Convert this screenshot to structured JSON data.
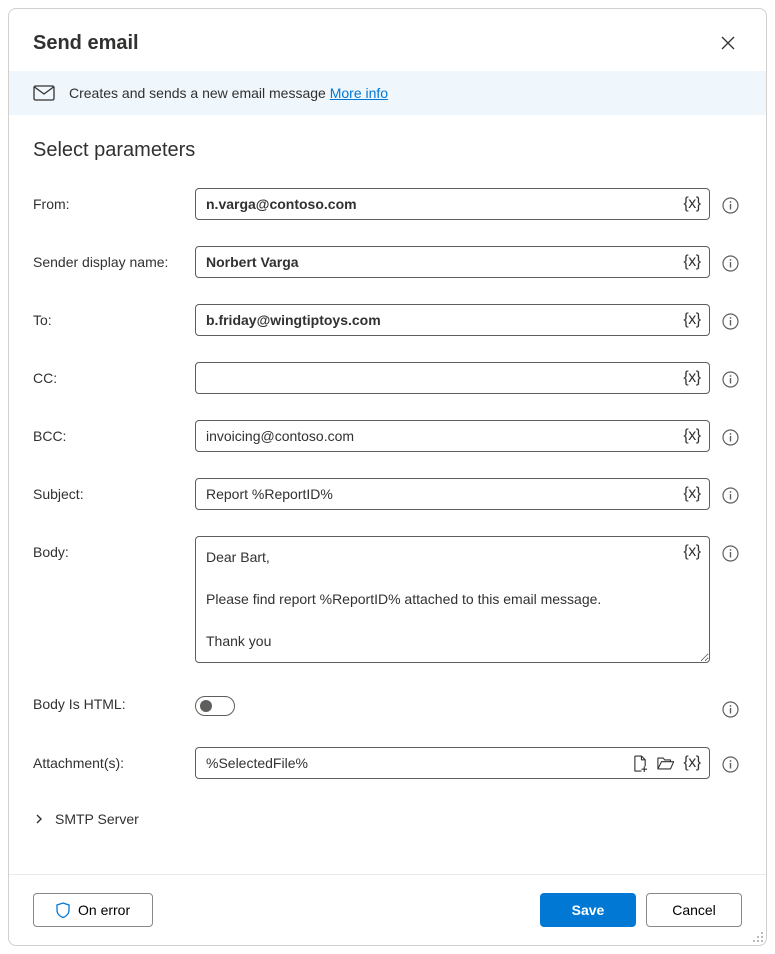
{
  "header": {
    "title": "Send email"
  },
  "info": {
    "text": "Creates and sends a new email message ",
    "link": "More info"
  },
  "section_title": "Select parameters",
  "params": {
    "from": {
      "label": "From:",
      "value": "n.varga@contoso.com"
    },
    "sender": {
      "label": "Sender display name:",
      "value": "Norbert Varga"
    },
    "to": {
      "label": "To:",
      "value": "b.friday@wingtiptoys.com"
    },
    "cc": {
      "label": "CC:",
      "value": ""
    },
    "bcc": {
      "label": "BCC:",
      "value": "invoicing@contoso.com"
    },
    "subject": {
      "label": "Subject:",
      "value": "Report %ReportID%"
    },
    "body": {
      "label": "Body:",
      "value": "Dear Bart,\n\nPlease find report %ReportID% attached to this email message.\n\nThank you"
    },
    "body_html": {
      "label": "Body Is HTML:"
    },
    "attachments": {
      "label": "Attachment(s):",
      "value": "%SelectedFile%"
    }
  },
  "smtp_section": "SMTP Server",
  "footer": {
    "on_error": "On error",
    "save": "Save",
    "cancel": "Cancel"
  },
  "icons": {
    "variable": "{x}"
  }
}
